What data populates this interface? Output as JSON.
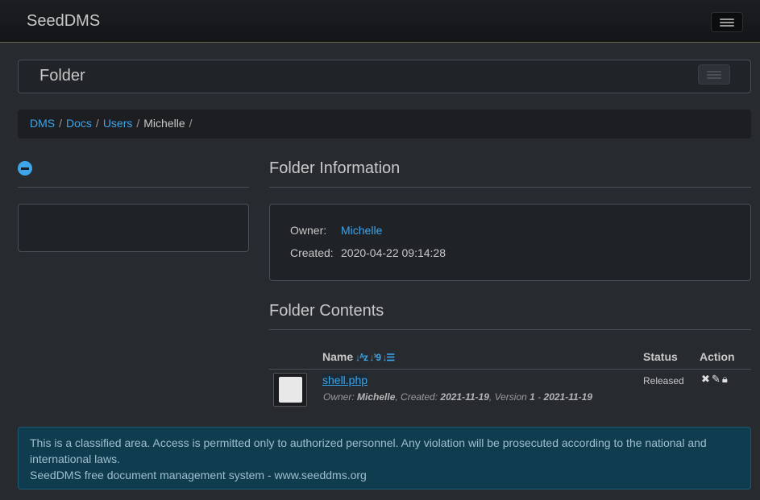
{
  "app": {
    "brand": "SeedDMS"
  },
  "folder_bar": {
    "title": "Folder"
  },
  "breadcrumb": {
    "items": [
      "DMS",
      "Docs",
      "Users"
    ],
    "current": "Michelle",
    "separator": "/"
  },
  "folder_info": {
    "heading": "Folder Information",
    "owner_label": "Owner:",
    "owner_value": "Michelle",
    "created_label": "Created:",
    "created_value": "2020-04-22 09:14:28"
  },
  "folder_contents": {
    "heading": "Folder Contents",
    "columns": {
      "name": "Name",
      "status": "Status",
      "action": "Action"
    },
    "rows": [
      {
        "file_name": "shell.php",
        "meta_owner_label": "Owner: ",
        "meta_owner": "Michelle",
        "meta_created_label": ", Created: ",
        "meta_created": "2021-11-19",
        "meta_version_label": ", Version ",
        "meta_version": "1",
        "meta_dash": " - ",
        "meta_date": "2021-11-19",
        "status": "Released"
      }
    ]
  },
  "footer": {
    "notice": "This is a classified area. Access is permitted only to authorized personnel. Any violation will be prosecuted according to the national and international laws.",
    "credit": "SeedDMS free document management system - www.seeddms.org"
  },
  "colors": {
    "link": "#3ea5e8",
    "background": "#272b30",
    "alert_bg": "#0f3d4f"
  },
  "icons": [
    "menu-icon",
    "collapse-icon",
    "sort-alpha-icon",
    "sort-numeric-icon",
    "sort-list-icon",
    "document-icon",
    "delete-icon",
    "edit-icon",
    "lock-icon"
  ]
}
